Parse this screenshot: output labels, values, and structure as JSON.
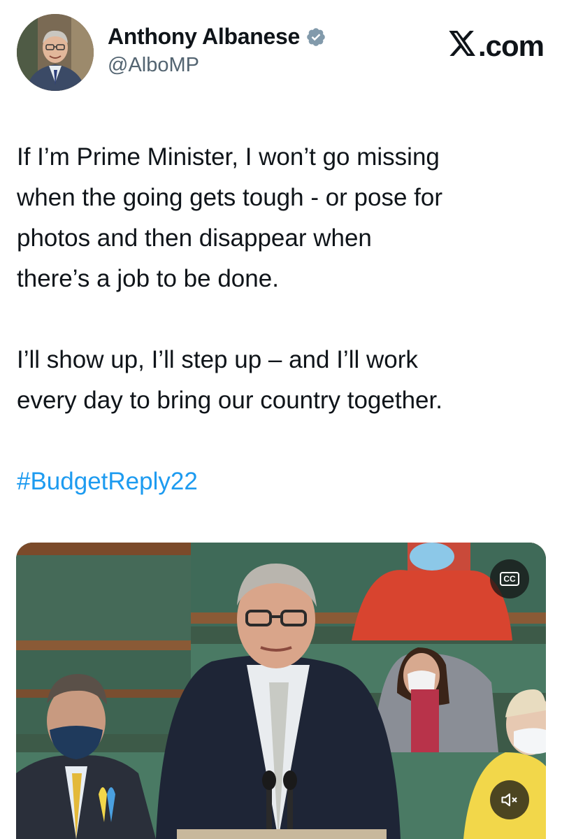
{
  "author": {
    "display_name": "Anthony Albanese",
    "handle": "@AlboMP",
    "verified": true,
    "avatar_icon": "profile-photo"
  },
  "brand": {
    "label": ".com",
    "icon": "x-logo-icon"
  },
  "tweet": {
    "paragraphs": [
      "If I’m Prime Minister, I won’t go missing when the going gets tough - or pose for photos and then disappear when there’s a job to be done.",
      "I’ll show up, I’ll step up – and I’ll work every day to bring our country together."
    ],
    "lines_p1": [
      "If I’m Prime Minister, I won’t go missing",
      "when the going gets tough - or pose for",
      "photos and then disappear when",
      "there’s a job to be done."
    ],
    "lines_p2": [
      "I’ll show up, I’ll step up – and I’ll work",
      "every day to bring our country together."
    ],
    "hashtag": "#BudgetReply22"
  },
  "media": {
    "type": "video",
    "cc_label": "CC",
    "controls": [
      "closed-captions-icon",
      "muted-speaker-icon"
    ]
  },
  "colors": {
    "link": "#1d9bf0",
    "verified": "#829aab",
    "text": "#0f1419",
    "secondary": "#536471"
  }
}
